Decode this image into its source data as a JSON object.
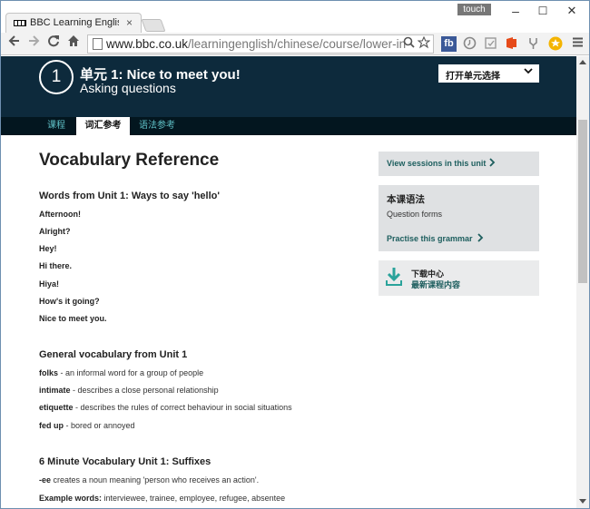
{
  "browser": {
    "tab_title": "BBC Learning English - C",
    "tab_close": "×",
    "touch_label": "touch",
    "window_minimize": "–",
    "window_maximize": "☐",
    "window_close": "✕",
    "url_host": "www.bbc.co.uk",
    "url_path": "/learningenglish/chinese/course/lower-inte",
    "extensions": [
      "fb",
      "clock",
      "shield",
      "office",
      "fork",
      "star",
      "menu"
    ]
  },
  "header": {
    "unit_number": "1",
    "unit_title": "单元 1: Nice to meet you!",
    "unit_subtitle": "Asking questions",
    "unit_select_label": "打开单元选择",
    "tabs": [
      {
        "label": "课程",
        "active": false
      },
      {
        "label": "词汇参考",
        "active": true
      },
      {
        "label": "语法参考",
        "active": false
      }
    ]
  },
  "main": {
    "page_title": "Vocabulary Reference",
    "section1": {
      "heading": "Words from Unit 1: Ways to say 'hello'",
      "items": [
        "Afternoon!",
        "Alright?",
        "Hey!",
        "Hi there.",
        "Hiya!",
        "How's it going?",
        "Nice to meet you."
      ]
    },
    "section2": {
      "heading": "General vocabulary from Unit 1",
      "items": [
        {
          "term": "folks",
          "definition": " - an informal word for a group of people"
        },
        {
          "term": "intimate",
          "definition": " - describes a close personal relationship"
        },
        {
          "term": "etiquette",
          "definition": " - describes the rules of correct behaviour in social situations"
        },
        {
          "term": "fed up",
          "definition": " - bored or annoyed"
        }
      ]
    },
    "section3": {
      "heading": "6 Minute Vocabulary Unit 1: Suffixes",
      "suffix_term": "-ee",
      "suffix_text": " creates a noun meaning 'person who receives an action'.",
      "example_label": "Example words:",
      "example_text": " interviewee, trainee, employee, refugee, absentee"
    }
  },
  "sidebar": {
    "sessions_link": "View sessions in this unit",
    "grammar_heading": "本课语法",
    "grammar_topic": "Question forms",
    "grammar_link": "Practise this grammar",
    "download_title": "下载中心",
    "download_sub": "最新课程内容"
  },
  "colors": {
    "header_bg": "#0d2a3c",
    "tab_bar_bg": "#03161f",
    "tab_text": "#5fc1c7",
    "sidebar_bg": "#dfe1e3",
    "link_teal": "#1d5e5e",
    "download_icon": "#2aa39b"
  }
}
